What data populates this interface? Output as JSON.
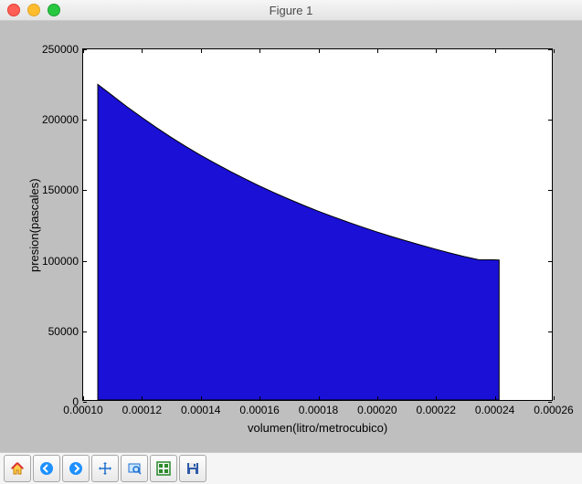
{
  "window": {
    "title": "Figure 1"
  },
  "toolbar": {
    "home": "Home",
    "back": "Back",
    "forward": "Forward",
    "pan": "Pan",
    "zoom": "Zoom",
    "subplots": "Configure subplots",
    "save": "Save"
  },
  "chart_data": {
    "type": "area",
    "title": "",
    "xlabel": "volumen(litro/metrocubico)",
    "ylabel": "presion(pascales)",
    "xlim": [
      0.0001,
      0.00026
    ],
    "ylim": [
      0,
      250000
    ],
    "xticks": [
      0.0001,
      0.00012,
      0.00014,
      0.00016,
      0.00018,
      0.0002,
      0.00022,
      0.00024,
      0.00026
    ],
    "xtick_labels": [
      "0.00010",
      "0.00012",
      "0.00014",
      "0.00016",
      "0.00018",
      "0.00020",
      "0.00022",
      "0.00024",
      "0.00026"
    ],
    "yticks": [
      0,
      50000,
      100000,
      150000,
      200000,
      250000
    ],
    "ytick_labels": [
      "0",
      "50000",
      "100000",
      "150000",
      "200000",
      "250000"
    ],
    "grid": false,
    "series": [
      {
        "name": "presion",
        "color": "#1a10d6",
        "edge": "#000000",
        "x": [
          0.000105,
          0.00011,
          0.000115,
          0.00012,
          0.000125,
          0.00013,
          0.000135,
          0.00014,
          0.000145,
          0.00015,
          0.000155,
          0.00016,
          0.000165,
          0.00017,
          0.000175,
          0.00018,
          0.000185,
          0.00019,
          0.000195,
          0.0002,
          0.000205,
          0.00021,
          0.000215,
          0.00022,
          0.000225,
          0.00023,
          0.000235,
          0.00024,
          0.000242
        ],
        "y": [
          225000,
          217000,
          209000,
          201500,
          194200,
          187300,
          180800,
          174600,
          168800,
          163200,
          157900,
          152800,
          148000,
          143400,
          139000,
          134800,
          130900,
          127100,
          123500,
          120000,
          116700,
          113600,
          110600,
          107700,
          104900,
          102300,
          100000,
          99900,
          99800
        ]
      }
    ]
  }
}
